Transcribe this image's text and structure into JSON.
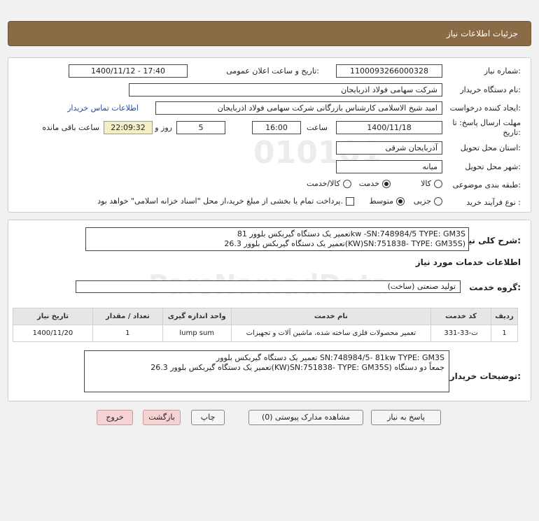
{
  "header": {
    "title": "جزئیات اطلاعات نیاز"
  },
  "form": {
    "need_number_label": "شماره نیاز:",
    "need_number": "1100093266000328",
    "announce_label": "تاریخ و ساعت اعلان عمومی:",
    "announce_value": "1400/11/12 - 17:40",
    "buyer_org_label": "نام دستگاه خریدار:",
    "buyer_org": "شرکت سهامی فولاد اذربایجان",
    "requester_label": "ایجاد کننده درخواست:",
    "requester": "امید شیخ الاسلامی کارشناس بازرگانی شرکت سهامی فولاد اذربایجان",
    "contact_link": "اطلاعات تماس خریدار",
    "deadline_label": "مهلت ارسال پاسخ: تا تاریخ:",
    "deadline_date": "1400/11/18",
    "time_label": "ساعت",
    "deadline_time": "16:00",
    "days_value": "5",
    "days_label": "روز و",
    "remaining_time": "22:09:32",
    "remaining_label": "ساعت باقی مانده",
    "province_label": "استان محل تحویل:",
    "province": "آذربایجان شرقی",
    "city_label": "شهر محل تحویل:",
    "city": "میانه",
    "category_label": "طبقه بندی موضوعی:",
    "category_options": [
      "کالا",
      "خدمت",
      "کالا/خدمت"
    ],
    "category_selected": "خدمت",
    "process_label": "نوع فرآیند خرید :",
    "process_options": [
      "جزیی",
      "متوسط"
    ],
    "process_selected": "متوسط",
    "payment_note": "پرداخت تمام یا بخشی از مبلغ خرید،از محل \"اسناد خزانه اسلامی\" خواهد بود."
  },
  "summary": {
    "label": "شرح کلی نیاز:",
    "line1": "تعمیر یک دستگاه گیربکس بلوور 81kw  -SN:748984/5   TYPE: GM3S",
    "line2": "تعمیر یک دستگاه گیربکس بلوور 26.3(KW)SN:751838-   TYPE: GM35S)"
  },
  "services": {
    "section_title": "اطلاعات خدمات مورد نیاز",
    "group_label": "گروه خدمت:",
    "group_value": "تولید صنعتی (ساخت)",
    "columns": [
      "ردیف",
      "کد خدمت",
      "نام خدمت",
      "واحد اندازه گیری",
      "تعداد / مقدار",
      "تاریخ نیاز"
    ],
    "rows": [
      [
        "1",
        "ت-33-331",
        "تعمیر محصولات فلزی ساخته شده، ماشین آلات و تجهیزات",
        "lump sum",
        "1",
        "1400/11/20"
      ]
    ]
  },
  "buyer_notes": {
    "label": "توضیحات خریدار:",
    "line1": "تعمیر یک دستگاه گیربکس بلوور  SN:748984/5-  81kw TYPE: GM3S",
    "line2": "تعمیر یک دستگاه گیربکس بلوور 26.3(KW)SN:751838-   TYPE: GM35S)    جمعاً دو دستگاه"
  },
  "buttons": {
    "reply": "پاسخ به نیاز",
    "attachments": "مشاهده مدارک پیوستی (0)",
    "print": "چاپ",
    "back": "بازگشت",
    "exit": "خروج"
  }
}
